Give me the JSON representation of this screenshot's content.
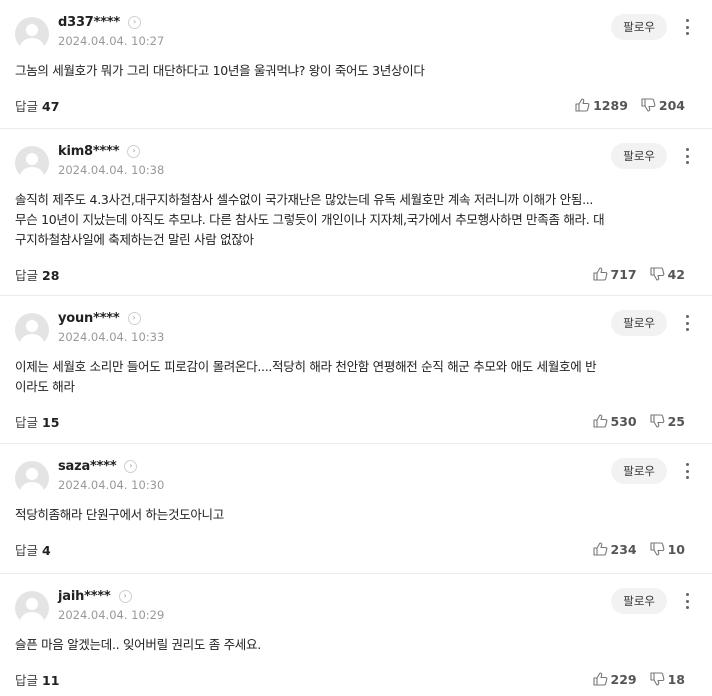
{
  "labels": {
    "follow": "팔로우",
    "reply": "답글"
  },
  "comments": [
    {
      "nick": "d337****",
      "date": "2024.04.04. 10:27",
      "lines": [
        "그놈의 세월호가 뭐가 그리 대단하다고 10년을 울궈먹냐? 왕이 죽어도 3년상이다"
      ],
      "replies": "47",
      "likes": "1289",
      "dislikes": "204"
    },
    {
      "nick": "kim8****",
      "date": "2024.04.04. 10:38",
      "lines": [
        "솔직히 제주도 4.3사건,대구지하철참사 셀수없이 국가재난은 많았는데 유독 세월호만 계속 저러니까 이해가 안됨...",
        "무슨 10년이 지났는데 아직도 추모냐. 다른 참사도 그렇듯이 개인이나 지자체,국가에서 추모행사하면 만족좀 해라. 대",
        "구지하철참사일에 축제하는건 말린 사람 없잖아"
      ],
      "replies": "28",
      "likes": "717",
      "dislikes": "42"
    },
    {
      "nick": "youn****",
      "date": "2024.04.04. 10:33",
      "lines": [
        "이제는 세월호 소리만 들어도 피로감이 몰려온다....적당히 해라 천안함 연평해전 순직 해군 추모와 애도 세월호에 반",
        "이라도 해라"
      ],
      "replies": "15",
      "likes": "530",
      "dislikes": "25"
    },
    {
      "nick": "saza****",
      "date": "2024.04.04. 10:30",
      "lines": [
        "적당히좀해라 단원구에서 하는것도아니고"
      ],
      "replies": "4",
      "likes": "234",
      "dislikes": "10"
    },
    {
      "nick": "jaih****",
      "date": "2024.04.04. 10:29",
      "lines": [
        "슬픈 마음 알겠는데.. 잊어버릴 권리도 좀 주세요."
      ],
      "replies": "11",
      "likes": "229",
      "dislikes": "18"
    }
  ]
}
